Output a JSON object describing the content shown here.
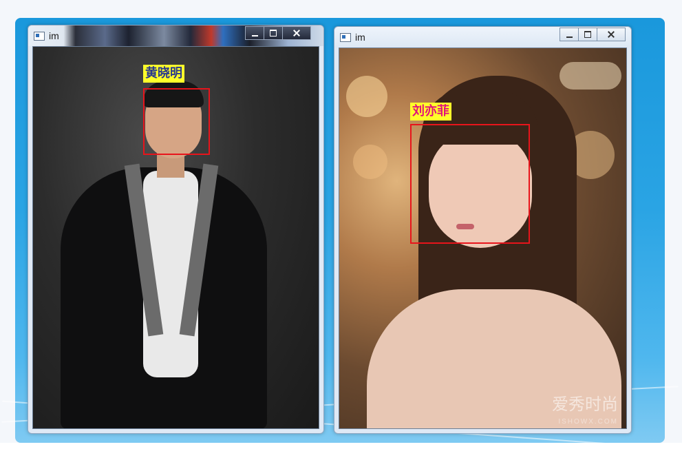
{
  "windows": [
    {
      "title": "im",
      "controls": [
        "minimize",
        "maximize",
        "close"
      ],
      "face_label": "黄晓明",
      "label_color": "#2b3a8c"
    },
    {
      "title": "im",
      "controls": [
        "minimize",
        "maximize",
        "close"
      ],
      "face_label": "刘亦菲",
      "label_color": "#e0137a",
      "watermark": "爱秀时尚",
      "watermark_sub": "ISHOWX.COM"
    }
  ],
  "colors": {
    "face_box": "#e8141b",
    "label_bg": "#ffff2a",
    "desktop_blue": "#1a98dc"
  }
}
